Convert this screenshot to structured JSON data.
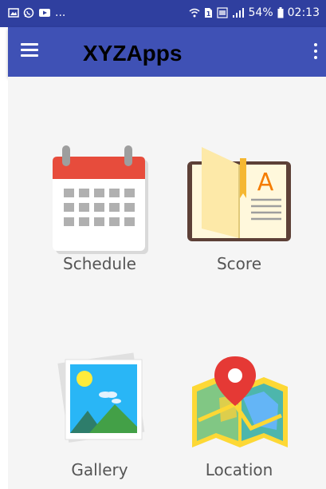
{
  "status_bar": {
    "left_icons": [
      "image-icon",
      "whatsapp-icon",
      "youtube-icon"
    ],
    "left_more": "...",
    "right_icons": [
      "wifi-icon",
      "sim-1-icon",
      "lte-icon",
      "signal-icon"
    ],
    "battery_percent": "54%",
    "battery_icon": "battery-icon",
    "time": "02:13"
  },
  "app_bar": {
    "menu_icon": "hamburger-menu-icon",
    "title": "XYZApps",
    "overflow_icon": "overflow-menu-icon",
    "background_color": "#3f51b5"
  },
  "tiles": [
    {
      "label": "Schedule",
      "icon": "calendar-icon"
    },
    {
      "label": "Score",
      "icon": "book-icon"
    },
    {
      "label": "Gallery",
      "icon": "photo-gallery-icon"
    },
    {
      "label": "Location",
      "icon": "map-pin-icon"
    }
  ],
  "colors": {
    "status_bar": "#2f3f9f",
    "app_bar": "#3f51b5",
    "content_background": "#f5f5f5",
    "label_text": "#555555"
  }
}
